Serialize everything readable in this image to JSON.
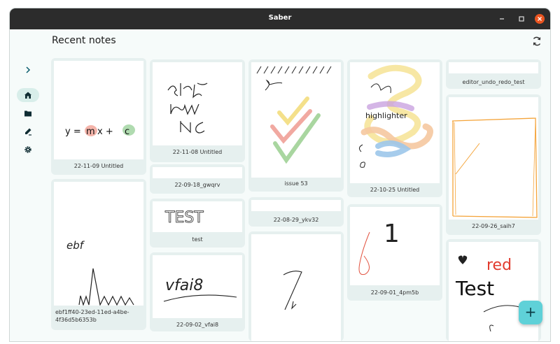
{
  "window": {
    "title": "Saber"
  },
  "header": {
    "title": "Recent notes"
  },
  "nav": {
    "items": [
      {
        "name": "home-icon"
      },
      {
        "name": "folder-icon"
      },
      {
        "name": "whiteboard-icon"
      },
      {
        "name": "gear-icon"
      }
    ]
  },
  "notes": {
    "n1": "22-11-09 Untitled",
    "n2": "ebf1ff40-23ed-11ed-a4be-4f36d5b6353b",
    "n3": "22-11-08 Untitled",
    "n4": "22-09-18_gwqrv",
    "n5": "test",
    "n6": "22-09-02_vfai8",
    "n7": "issue 53",
    "n8": "22-08-29_ykv32",
    "n9": "22-10-25 Untitled",
    "n10": "22-09-01_4pm5b",
    "n11": "editor_undo_redo_test",
    "n12": "22-09-26_saih7"
  },
  "thumb_text": {
    "eq_y": "y =",
    "eq_m": "m",
    "eq_x": "x +",
    "eq_c": "c",
    "ebf": "ebf",
    "test_caps": "TEST",
    "vfai8": "vfai8",
    "highlighter": "highlighter",
    "one": "1",
    "red": "red",
    "test_word": "Test"
  },
  "fab": {
    "label": "+"
  },
  "colors": {
    "accent": "#5fd1d8",
    "close": "#e95420",
    "card": "#e6f0ef"
  }
}
